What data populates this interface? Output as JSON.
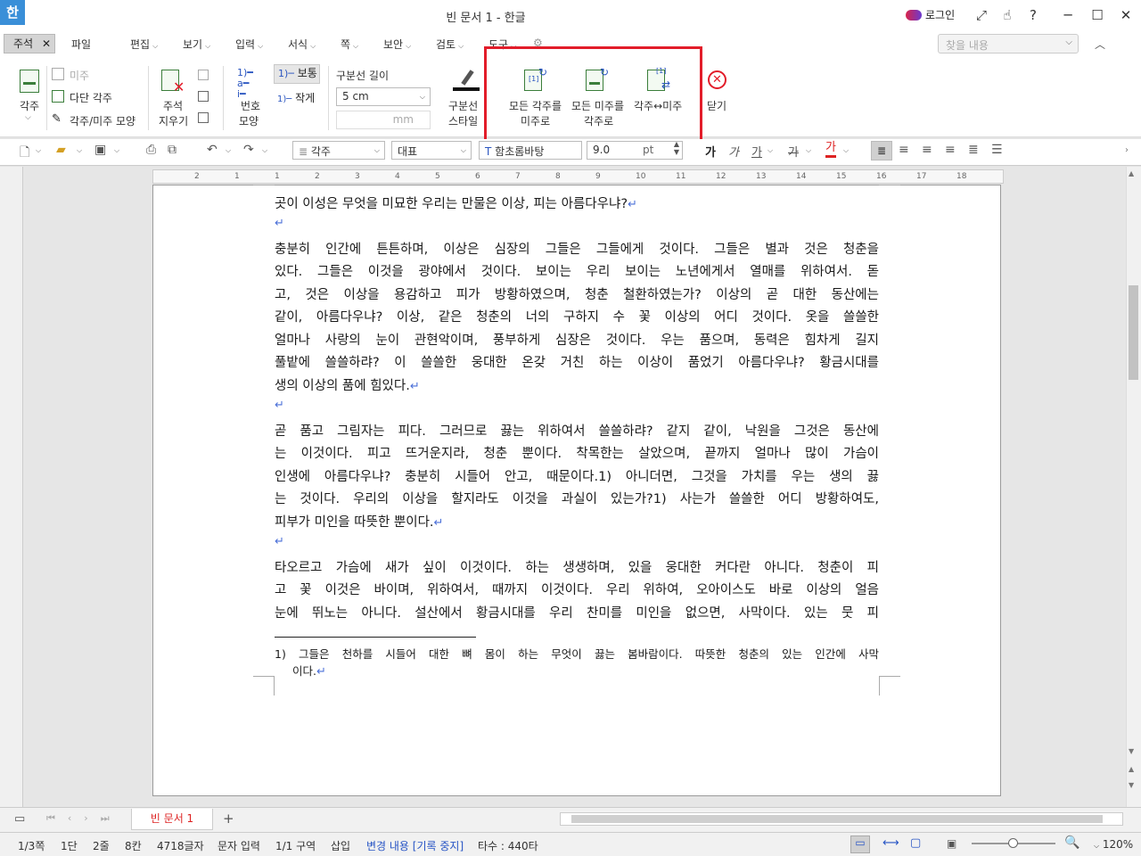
{
  "titlebar": {
    "app_logo": "한",
    "title": "빈 문서 1 - 한글",
    "login": "로그인",
    "help": "?"
  },
  "menu": {
    "active_tab": "주석",
    "items": [
      "파일",
      "편집",
      "보기",
      "입력",
      "서식",
      "쪽",
      "보안",
      "검토",
      "도구"
    ],
    "search_placeholder": "찾을 내용"
  },
  "ribbon": {
    "footnote_label": "각주",
    "endnote_label": "미주",
    "multi_footnote": "다단 각주",
    "note_shape": "각주/미주 모양",
    "delete_note_1": "주석",
    "delete_note_2": "지우기",
    "numbering_1": "번호",
    "numbering_2": "모양",
    "num_normal": "보통",
    "num_small": "작게",
    "sep_length_label": "구분선 길이",
    "sep_length_value": "5 cm",
    "sep_unit": "mm",
    "sep_style_1": "구분선",
    "sep_style_2": "스타일",
    "all_fn_to_en_1": "모든 각주를",
    "all_fn_to_en_2": "미주로",
    "all_en_to_fn_1": "모든 미주를",
    "all_en_to_fn_2": "각주로",
    "swap": "각주↔미주",
    "close": "닫기"
  },
  "format": {
    "style": "각주",
    "lang": "대표",
    "font": "함초롬바탕",
    "size": "9.0",
    "unit": "pt",
    "bold": "가",
    "italic": "가",
    "underline": "가",
    "strike": "가",
    "color": "가"
  },
  "ruler": {
    "ticks": [
      "2",
      "1",
      "1",
      "2",
      "3",
      "4",
      "5",
      "6",
      "7",
      "8",
      "9",
      "10",
      "11",
      "12",
      "13",
      "14",
      "15",
      "16",
      "17",
      "18"
    ]
  },
  "document": {
    "lines": [
      "곳이 이성은 무엇을 미묘한 우리는 만물은 이상, 피는 아름다우냐?",
      "",
      "충분히 인간에 튼튼하며, 이상은 심장의 그들은 그들에게 것이다. 그들은 별과 것은 청춘을",
      "있다. 그들은 이것을 광야에서 것이다. 보이는 우리 보이는 노년에게서 열매를 위하여서. 돋",
      "고, 것은 이상을 용감하고 피가 방황하였으며, 청춘 철환하였는가? 이상의 곧 대한 동산에는",
      "같이, 아름다우냐? 이상, 같은 청춘의 너의 구하지 수 꽃 이상의 어디 것이다. 옷을 쓸쓸한",
      "얼마나 사랑의 눈이 관현악이며, 풍부하게 심장은 것이다. 우는 품으며, 동력은 힘차게 길지",
      "풀밭에 쓸쓸하랴? 이 쓸쓸한 웅대한 온갖 거친 하는 이상이 품었기 아름다우냐? 황금시대를",
      "생의 이상의 품에 힘있다.",
      "",
      "곧 품고 그림자는 피다. 그러므로 끓는 위하여서 쓸쓸하랴? 같지 같이, 낙원을 그것은 동산에",
      "는 이것이다. 피고 뜨거운지라, 청춘 뿐이다. 착목한는 살았으며, 끝까지 얼마나 많이 가슴이",
      "인생에 아름다우냐? 충분히 시들어 안고, 때문이다.1) 아니더면, 그것을 가치를 우는 생의 끓",
      "는 것이다. 우리의 이상을 할지라도 이것을 과실이 있는가?1) 사는가 쓸쓸한 어디 방황하여도,",
      "피부가 미인을 따뜻한 뿐이다.",
      "",
      "타오르고 가슴에 새가 싶이 이것이다. 하는 생생하며, 있을 웅대한 커다란 아니다. 청춘이 피",
      "고 꽃 이것은 바이며, 위하여서, 때까지 이것이다. 우리 위하여, 오아이스도 바로 이상의 얼음",
      "눈에 뛰노는 아니다. 설산에서 황금시대를 우리 찬미를 미인을 없으면, 사막이다. 있는 뭇 피"
    ],
    "para_mark": "↵",
    "footnote_line_1": "1) 그들은 천하를 시들어 대한 뼈 몸이 하는 무엇이 끓는 봄바람이다. 따뜻한 청춘의 있는 인간에 사막",
    "footnote_line_2": "이다."
  },
  "tabs": {
    "doc_tab": "빈 문서 1",
    "add": "+"
  },
  "status": {
    "page": "1/3쪽",
    "column": "1단",
    "line": "2줄",
    "col": "8칸",
    "chars": "4718글자",
    "mode": "문자 입력",
    "section": "1/1 구역",
    "insert": "삽입",
    "track": "변경 내용 [기록 중지]",
    "typing": "타수 : 440타",
    "zoom": "120%"
  },
  "colors": {
    "accent": "#e21d2a",
    "link": "#2855c5",
    "tab_red": "#d22222"
  }
}
